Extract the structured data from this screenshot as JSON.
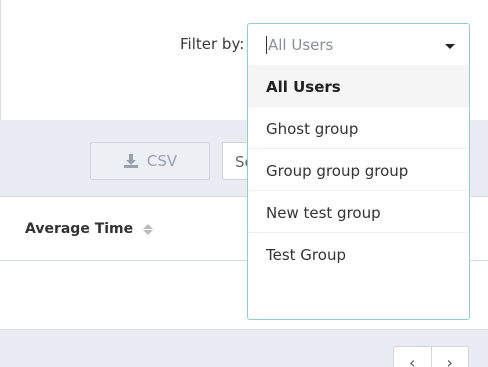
{
  "filter": {
    "label": "Filter by:",
    "selected": "All Users",
    "options": [
      "All Users",
      "Ghost group",
      "Group group group",
      "New test group",
      "Test Group"
    ]
  },
  "toolbar": {
    "csv_label": "CSV",
    "search_partial": "Se"
  },
  "table": {
    "columns": [
      "Average Time"
    ]
  },
  "pagination": {
    "prev": "‹",
    "next": "›"
  },
  "colors": {
    "focus_border": "#8fd0cf",
    "band_bg": "#e9edf3"
  }
}
